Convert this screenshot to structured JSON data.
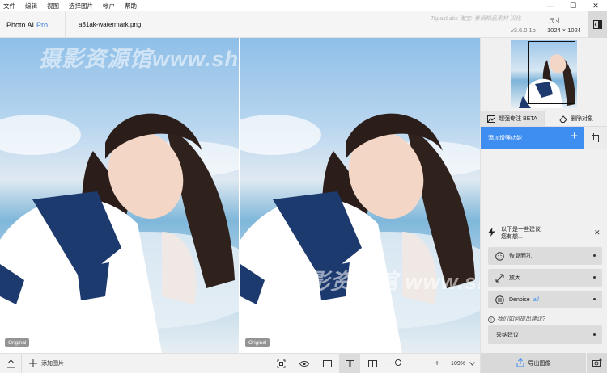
{
  "menu": {
    "items": [
      "文件",
      "编辑",
      "视图",
      "选择图片",
      "帐户",
      "帮助"
    ]
  },
  "window": {
    "minimize": "—",
    "maximize": "☐",
    "close": "✕"
  },
  "header": {
    "brand": "Photo AI",
    "brand_badge": "Pro",
    "filename": "a81ak-watermark.png",
    "watermark_note": "TopazLabs 淘宝: 春调精品素材 汉化",
    "version": "v3.6.0.1b",
    "size_label": "尺寸",
    "size_value": "1024 × 1024"
  },
  "viewer": {
    "left_tag": "Original",
    "right_tag": "Original",
    "watermark_1": "摄影资源馆www.sheyingzyg.com",
    "watermark_2": "摄影资源馆 www.sheyin"
  },
  "bottombar": {
    "add_image": "添加图片",
    "zoom_level": "109%",
    "zoom_fraction": 0.05
  },
  "panel": {
    "tab_upscale": "超强专注 BETA",
    "tab_remove": "删除对象",
    "add_enhance": "添加增强功能",
    "suggest_line1": "以下是一些建议",
    "suggest_line2": "您有想...",
    "suggestions": [
      {
        "label": "恢复面孔",
        "icon": "face-icon"
      },
      {
        "label": "放大",
        "icon": "expand-icon"
      },
      {
        "label": "Denoise",
        "badge": "all",
        "icon": "denoise-icon"
      }
    ],
    "question": "我们如何提出建议?",
    "accept": "采纳建议",
    "export": "导出图像"
  },
  "colors": {
    "accent": "#3d8ef0",
    "brand_pro": "#3a7bd5"
  }
}
